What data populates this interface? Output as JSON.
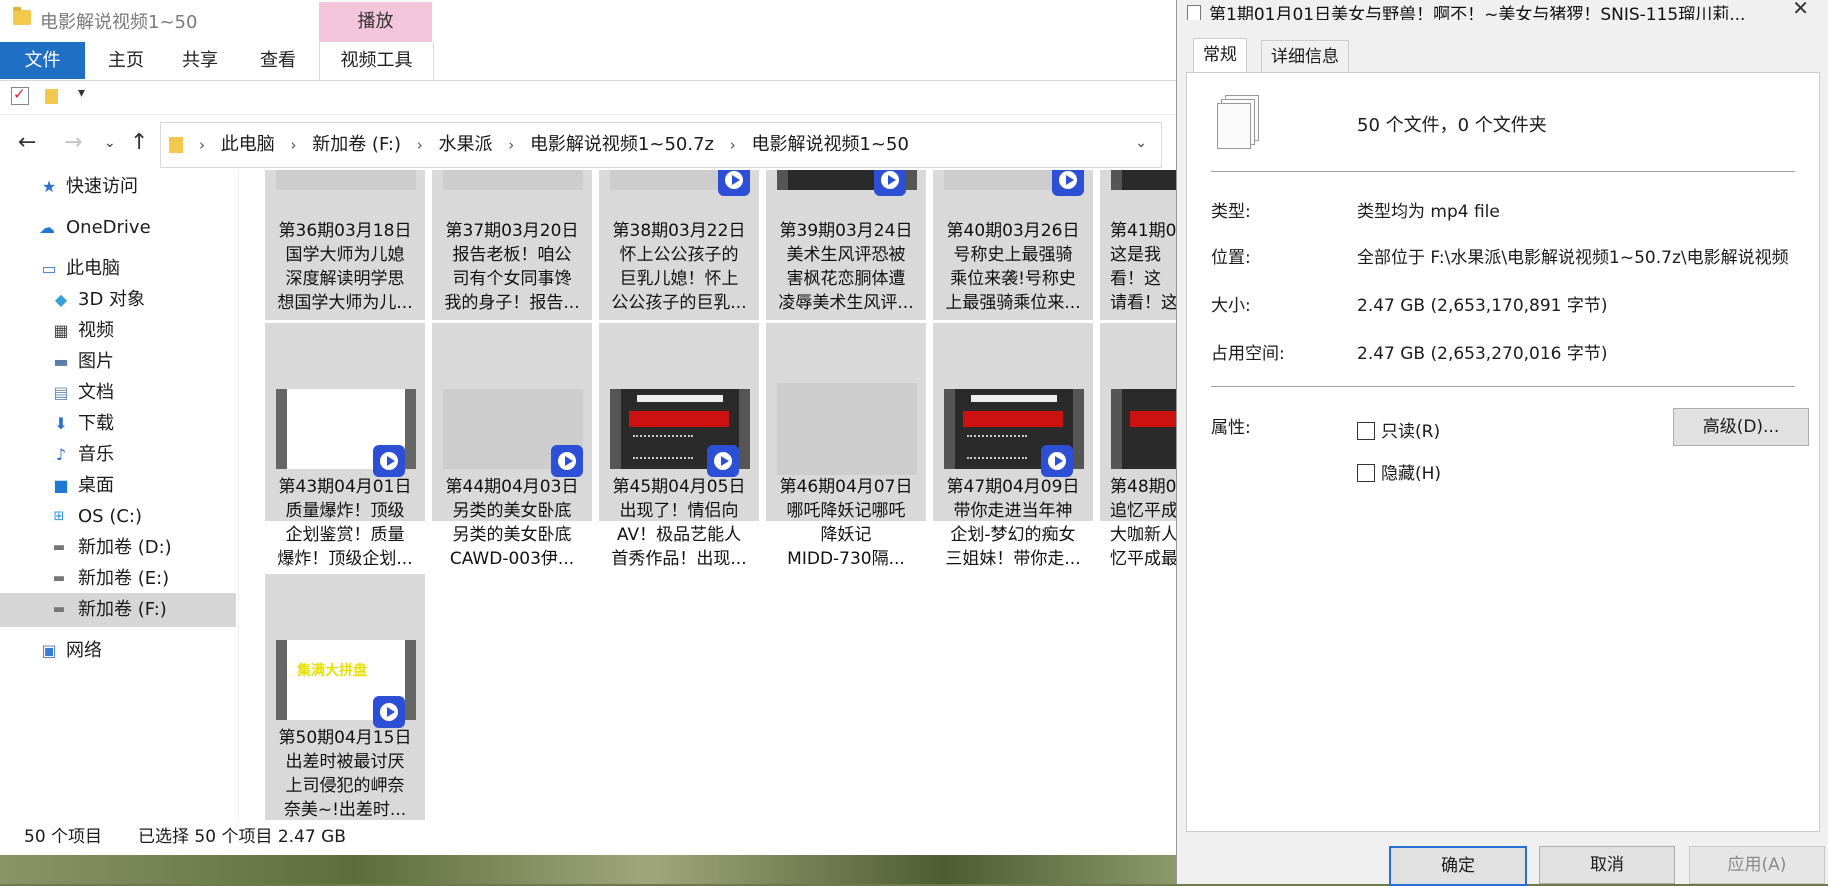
{
  "explorer": {
    "title": "电影解说视频1~50",
    "ribbon": {
      "context_tab": "播放",
      "tabs": [
        "文件",
        "主页",
        "共享",
        "查看",
        "视频工具"
      ]
    },
    "breadcrumbs": [
      "此电脑",
      "新加卷 (F:)",
      "水果派",
      "电影解说视频1~50.7z",
      "电影解说视频1~50"
    ],
    "nav": [
      {
        "label": "快速访问",
        "icon": "star-icon"
      },
      {
        "label": "OneDrive",
        "icon": "cloud-icon"
      },
      {
        "label": "此电脑",
        "icon": "computer-icon"
      },
      {
        "label": "3D 对象",
        "icon": "cube-icon"
      },
      {
        "label": "视频",
        "icon": "film-icon"
      },
      {
        "label": "图片",
        "icon": "picture-icon"
      },
      {
        "label": "文档",
        "icon": "document-icon"
      },
      {
        "label": "下载",
        "icon": "download-icon"
      },
      {
        "label": "音乐",
        "icon": "music-icon"
      },
      {
        "label": "桌面",
        "icon": "desktop-icon"
      },
      {
        "label": "OS (C:)",
        "icon": "windows-drive-icon"
      },
      {
        "label": "新加卷 (D:)",
        "icon": "drive-icon"
      },
      {
        "label": "新加卷 (E:)",
        "icon": "drive-icon"
      },
      {
        "label": "新加卷 (F:)",
        "icon": "drive-icon"
      },
      {
        "label": "网络",
        "icon": "network-icon"
      }
    ],
    "files_row1": [
      {
        "lines": [
          "第36期03月18日",
          "国学大师为儿媳",
          "深度解读明学思",
          "想国学大师为儿..."
        ]
      },
      {
        "lines": [
          "第37期03月20日",
          "报告老板！咱公",
          "司有个女同事馋",
          "我的身子！报告..."
        ]
      },
      {
        "lines": [
          "第38期03月22日",
          "怀上公公孩子的",
          "巨乳儿媳！怀上",
          "公公孩子的巨乳..."
        ]
      },
      {
        "lines": [
          "第39期03月24日",
          "美术生风评恐被",
          "害枫花恋胴体遭",
          "凌辱美术生风评..."
        ]
      },
      {
        "lines": [
          "第40期03月26日",
          "号称史上最强骑",
          "乘位来袭!号称史",
          "上最强骑乘位来..."
        ]
      },
      {
        "lines": [
          "第41期0",
          "这是我",
          "看！这",
          "请看！这"
        ]
      }
    ],
    "files_row2": [
      {
        "lines": [
          "第43期04月01日",
          "质量爆炸！顶级",
          "企划鉴赏！质量",
          "爆炸！顶级企划..."
        ]
      },
      {
        "lines": [
          "第44期04月03日",
          "另类的美女卧底",
          "另类的美女卧底",
          "CAWD-003伊..."
        ]
      },
      {
        "lines": [
          "第45期04月05日",
          "出现了！情侣向",
          "AV！极品艺能人",
          "首秀作品！出现..."
        ]
      },
      {
        "lines": [
          "第46期04月07日",
          "哪吒降妖记哪吒",
          "降妖记",
          "MIDD-730隔..."
        ]
      },
      {
        "lines": [
          "第47期04月09日",
          "带你走进当年神",
          "企划-梦幻的痴女",
          "三姐妹！带你走..."
        ]
      },
      {
        "lines": [
          "第48期0",
          "追忆平成",
          "大咖新人",
          "忆平成最"
        ]
      }
    ],
    "files_row3": [
      {
        "lines": [
          "第50期04月15日",
          "出差时被最讨厌",
          "上司侵犯的岬奈",
          "奈美~!出差时..."
        ]
      }
    ],
    "thumb_texts": {
      "banner_top": "本视频含有成人内容",
      "banner_red": "未满18岁禁止观看",
      "yellow": "集满大拼盘"
    },
    "status": {
      "count": "50 个项目",
      "selected": "已选择 50 个项目  2.47 GB"
    }
  },
  "props": {
    "title": "第1期01月01日美女与野兽！啊不！~美女与猪猡！SNIS-115瑠川莉...",
    "close": "✕",
    "tabs": [
      "常规",
      "详细信息"
    ],
    "summary": "50 个文件，0 个文件夹",
    "rows": [
      {
        "label": "类型:",
        "value": "类型均为 mp4 file"
      },
      {
        "label": "位置:",
        "value": "全部位于 F:\\水果派\\电影解说视频1~50.7z\\电影解说视频"
      },
      {
        "label": "大小:",
        "value": "2.47 GB (2,653,170,891 字节)"
      },
      {
        "label": "占用空间:",
        "value": "2.47 GB (2,653,270,016 字节)"
      }
    ],
    "attr_label": "属性:",
    "readonly": "只读(R)",
    "hidden": "隐藏(H)",
    "advanced": "高级(D)...",
    "ok": "确定",
    "cancel": "取消",
    "apply": "应用(A)"
  }
}
